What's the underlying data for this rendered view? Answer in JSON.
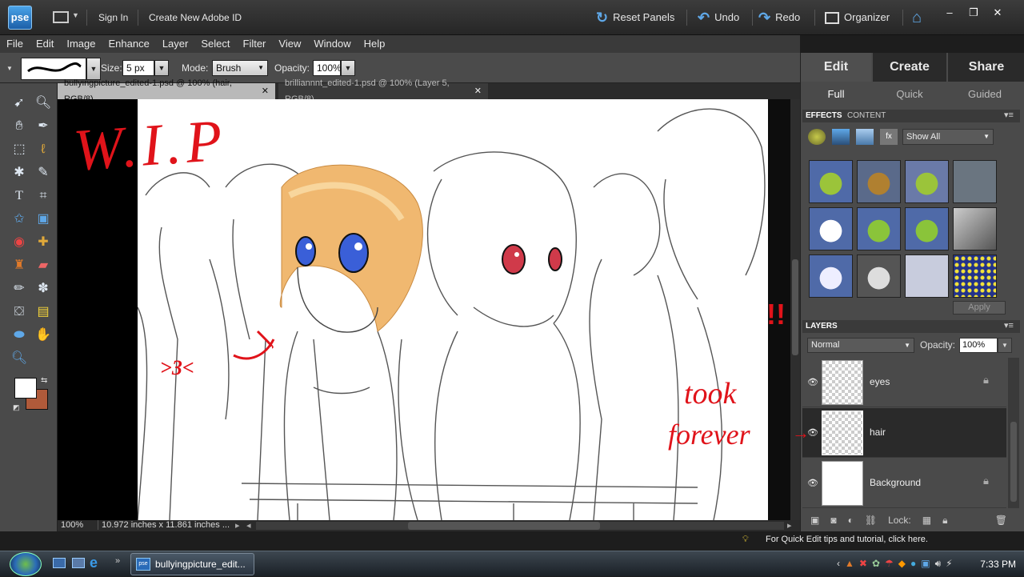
{
  "app": {
    "logo": "pse"
  },
  "titlebar": {
    "sign_in": "Sign In",
    "create_id": "Create New Adobe ID",
    "reset_panels": "Reset Panels",
    "undo": "Undo",
    "redo": "Redo",
    "organizer": "Organizer"
  },
  "menu": [
    "File",
    "Edit",
    "Image",
    "Enhance",
    "Layer",
    "Select",
    "Filter",
    "View",
    "Window",
    "Help"
  ],
  "options": {
    "size_label": "Size:",
    "size_value": "5 px",
    "mode_label": "Mode:",
    "mode_value": "Brush",
    "opacity_label": "Opacity:",
    "opacity_value": "100%"
  },
  "tabs": [
    {
      "label": "bullyingpicture_edited-1.psd @ 100% (hair, RGB/8)",
      "active": true
    },
    {
      "label": "brilliannnt_edited-1.psd @ 100% (Layer 5, RGB/8)",
      "active": false
    }
  ],
  "status": {
    "zoom": "100%",
    "doc_size": "10.972 inches x 11.861 inches ..."
  },
  "artwork": {
    "wip": "W.I.P",
    "took": "took",
    "forever": "forever",
    "emoticon": ">3<"
  },
  "panel": {
    "modes": [
      "Edit",
      "Create",
      "Share"
    ],
    "submodes": [
      "Full",
      "Quick",
      "Guided"
    ],
    "effects_tab": "EFFECTS",
    "content_tab": "CONTENT",
    "show_all": "Show All",
    "apply": "Apply",
    "layers_title": "LAYERS",
    "blend_mode": "Normal",
    "opacity_label": "Opacity:",
    "opacity_value": "100%",
    "layers": [
      {
        "name": "eyes",
        "locked": true
      },
      {
        "name": "hair",
        "locked": false,
        "selected": true
      },
      {
        "name": "Background",
        "locked": true
      }
    ],
    "lock_label": "Lock:"
  },
  "tip": "For Quick Edit tips and tutorial, click here.",
  "taskbar": {
    "item": "bullyingpicture_edit...",
    "time": "7:33 PM"
  },
  "colors": {
    "accent": "#3a8fd8",
    "swatch_fg": "#ffffff",
    "swatch_bg": "#b05a3a",
    "annotation": "#e0131a"
  }
}
